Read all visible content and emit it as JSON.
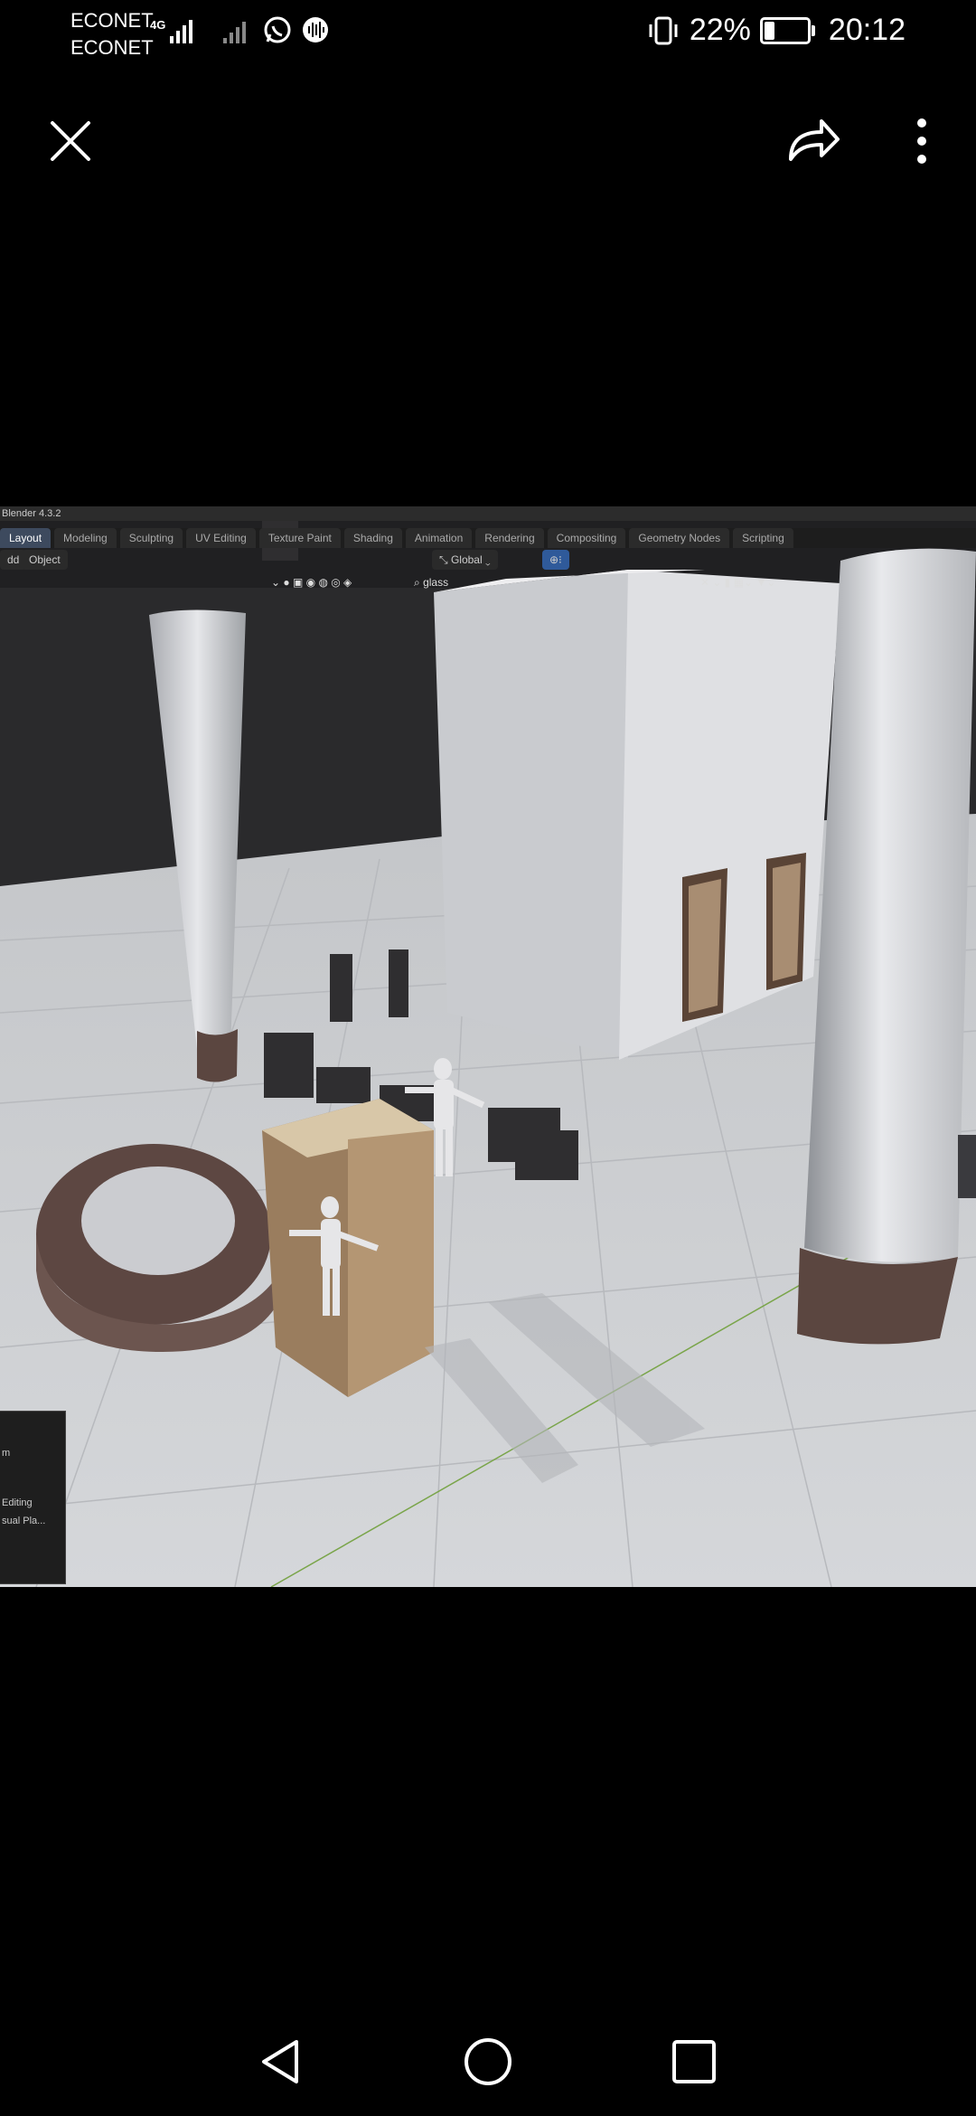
{
  "status": {
    "carrier1": "ECONET",
    "carrier2": "ECONET",
    "network": "4G",
    "battery_percent": "22%",
    "battery_level": 0.22,
    "time": "20:12"
  },
  "viewer": {
    "close_icon": "close-icon",
    "share_icon": "share-icon",
    "more_icon": "more-vertical-icon"
  },
  "blender": {
    "title": "Blender 4.3.2",
    "tabs": [
      "Layout",
      "Modeling",
      "Sculpting",
      "UV Editing",
      "Texture Paint",
      "Shading",
      "Animation",
      "Rendering",
      "Compositing",
      "Geometry Nodes",
      "Scripting"
    ],
    "active_tab": "Layout",
    "menu_add": "dd",
    "menu_object": "Object",
    "orientation": "Global",
    "search": "glass",
    "panel_lines": [
      "m",
      "Editing",
      "sual Pla..."
    ]
  },
  "navbar": {
    "back": "back-icon",
    "home": "home-icon",
    "recents": "recents-icon"
  }
}
